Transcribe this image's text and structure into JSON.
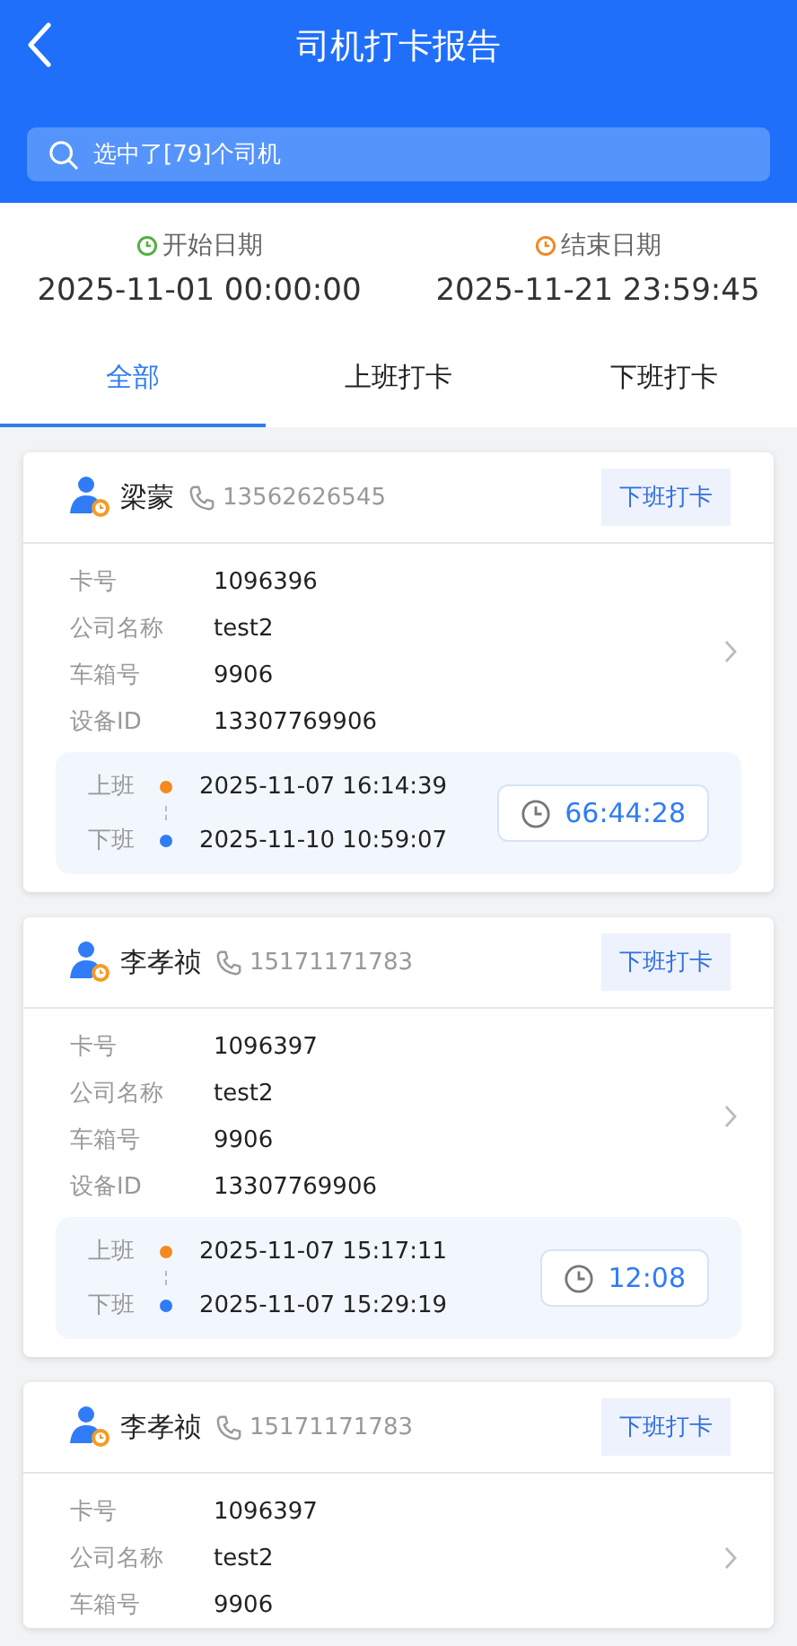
{
  "header": {
    "title": "司机打卡报告"
  },
  "search": {
    "placeholder": "选中了[79]个司机"
  },
  "dates": [
    {
      "kind": "start",
      "label": "开始日期",
      "value": "2025-11-01 00:00:00"
    },
    {
      "kind": "end",
      "label": "结束日期",
      "value": "2025-11-21 23:59:45"
    }
  ],
  "tabs": [
    {
      "label": "全部",
      "selected": true
    },
    {
      "label": "上班打卡",
      "selected": false
    },
    {
      "label": "下班打卡",
      "selected": false
    }
  ],
  "cards": [
    {
      "name": "梁蒙",
      "phone": "13562626545",
      "action": "下班打卡",
      "fields": [
        {
          "label": "卡号",
          "value": "1096396"
        },
        {
          "label": "公司名称",
          "value": "test2"
        },
        {
          "label": "车箱号",
          "value": "9906"
        },
        {
          "label": "设备ID",
          "value": "13307769906"
        }
      ],
      "punch": {
        "in_label": "上班",
        "in_time": "2025-11-07 16:14:39",
        "out_label": "下班",
        "out_time": "2025-11-10 10:59:07",
        "duration": "66:44:28"
      }
    },
    {
      "name": "李孝祯",
      "phone": "15171171783",
      "action": "下班打卡",
      "fields": [
        {
          "label": "卡号",
          "value": "1096397"
        },
        {
          "label": "公司名称",
          "value": "test2"
        },
        {
          "label": "车箱号",
          "value": "9906"
        },
        {
          "label": "设备ID",
          "value": "13307769906"
        }
      ],
      "punch": {
        "in_label": "上班",
        "in_time": "2025-11-07 15:17:11",
        "out_label": "下班",
        "out_time": "2025-11-07 15:29:19",
        "duration": "12:08"
      }
    },
    {
      "name": "李孝祯",
      "phone": "15171171783",
      "action": "下班打卡",
      "fields": [
        {
          "label": "卡号",
          "value": "1096397"
        },
        {
          "label": "公司名称",
          "value": "test2"
        },
        {
          "label": "车箱号",
          "value": "9906"
        }
      ]
    }
  ]
}
